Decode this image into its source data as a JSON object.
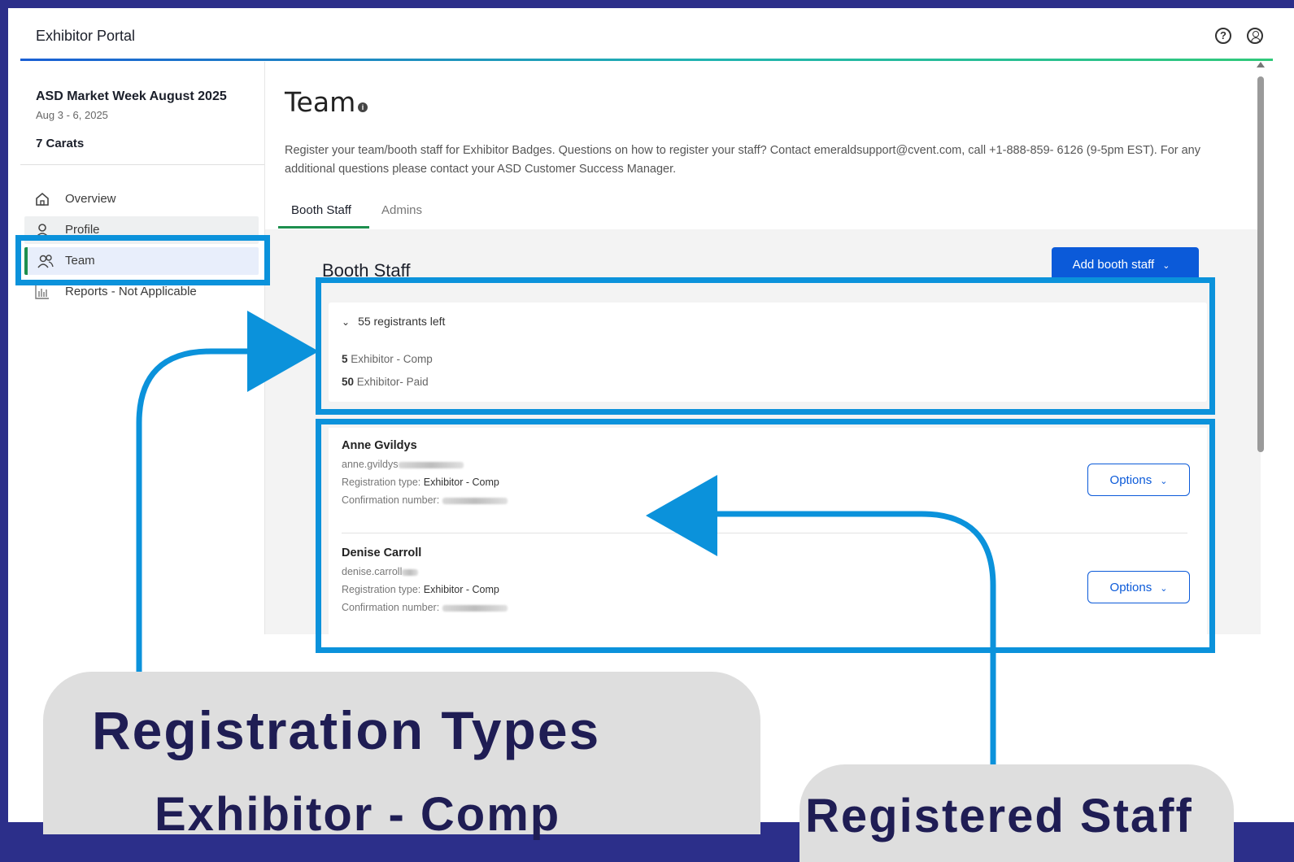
{
  "app": {
    "title": "Exhibitor Portal",
    "help_icon": "help-circle-icon",
    "user_icon": "user-circle-icon"
  },
  "sidebar": {
    "event_name": "ASD Market Week August 2025",
    "event_dates": "Aug 3 - 6, 2025",
    "company": "7 Carats",
    "items": [
      {
        "label": "Overview",
        "icon": "home-icon"
      },
      {
        "label": "Profile",
        "icon": "person-icon"
      },
      {
        "label": "Team",
        "icon": "team-icon",
        "active": true
      },
      {
        "label": "Reports - Not Applicable",
        "icon": "bar-chart-icon"
      }
    ]
  },
  "main": {
    "title": "Team",
    "description": "Register your team/booth staff for Exhibitor Badges. Questions on how to register your staff? Contact emeraldsupport@cvent.com, call +1-888-859- 6126 (9-5pm EST). For any additional questions please contact your ASD Customer Success Manager.",
    "tabs": [
      {
        "label": "Booth Staff",
        "active": true
      },
      {
        "label": "Admins",
        "active": false
      }
    ],
    "section_title": "Booth Staff",
    "add_button": "Add booth staff",
    "registrants": {
      "summary": "55 registrants left",
      "rows": [
        {
          "count": "5",
          "type": "Exhibitor - Comp"
        },
        {
          "count": "50",
          "type": "Exhibitor- Paid"
        }
      ]
    },
    "staff": [
      {
        "name": "Anne Gvildys",
        "email": "anne.gvildys",
        "reg_label": "Registration type:",
        "reg_type": "Exhibitor - Comp",
        "conf_label": "Confirmation number:",
        "options_label": "Options"
      },
      {
        "name": "Denise Carroll",
        "email": "denise.carroll",
        "reg_label": "Registration type:",
        "reg_type": "Exhibitor - Comp",
        "conf_label": "Confirmation number:",
        "options_label": "Options"
      }
    ]
  },
  "annotations": {
    "left_title": "Registration Types",
    "left_sub": "Exhibitor - Comp",
    "right_title": "Registered Staff",
    "accent_color": "#0b92db",
    "frame_color": "#2c2f8a"
  }
}
